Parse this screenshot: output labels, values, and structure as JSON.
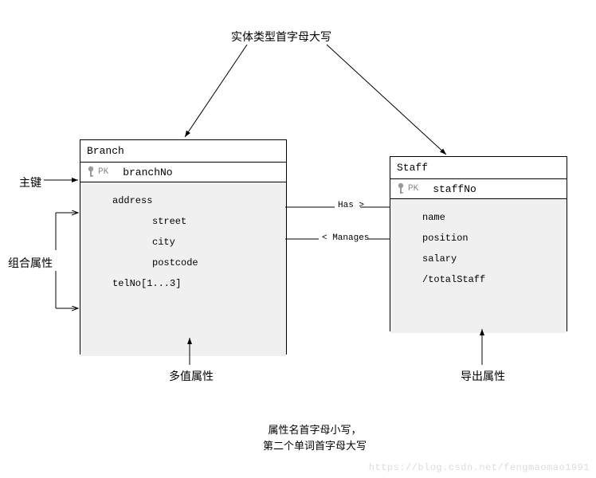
{
  "annotations": {
    "top": "实体类型首字母大写",
    "pk": "主键",
    "composite": "组合属性",
    "multivalue": "多值属性",
    "derived": "导出属性",
    "bottom_line1": "属性名首字母小写，",
    "bottom_line2": "第二个单词首字母大写"
  },
  "entities": {
    "branch": {
      "name": "Branch",
      "pk_label": "PK",
      "pk_attr": "branchNo",
      "attrs": {
        "address": "address",
        "street": "street",
        "city": "city",
        "postcode": "postcode",
        "telNo": "telNo[1...3]"
      }
    },
    "staff": {
      "name": "Staff",
      "pk_label": "PK",
      "pk_attr": "staffNo",
      "attrs": {
        "name": "name",
        "position": "position",
        "salary": "salary",
        "totalStaff": "/totalStaff"
      }
    }
  },
  "relationships": {
    "has": "Has",
    "manages": "Manages"
  },
  "watermark": "https://blog.csdn.net/fengmaomao1991"
}
